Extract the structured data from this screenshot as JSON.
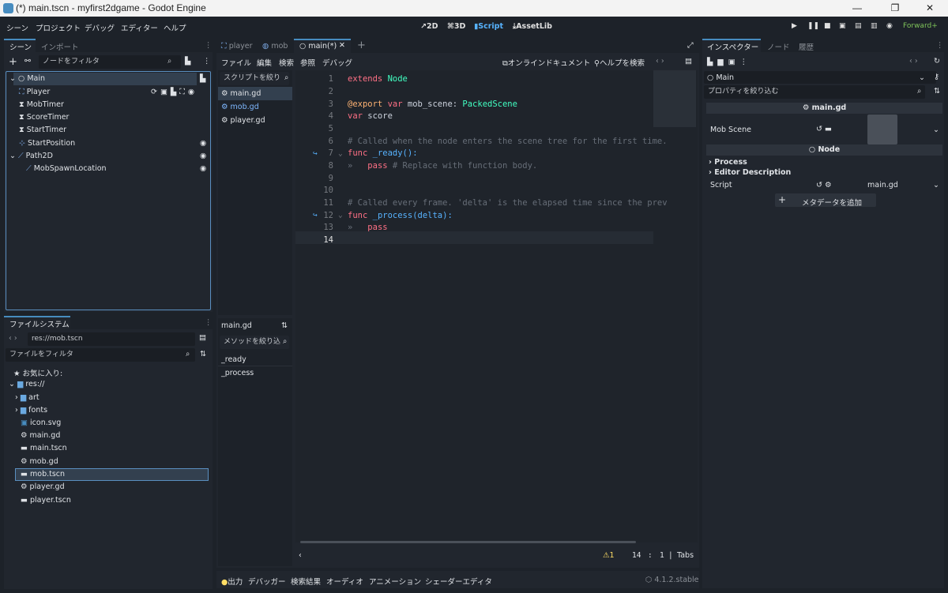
{
  "window": {
    "title": "(*) main.tscn - myfirst2dgame - Godot Engine",
    "minimize": "—",
    "maximize": "❐",
    "close": "✕"
  },
  "menubar": {
    "items": [
      "シーン",
      "プロジェクト",
      "デバッグ",
      "エディター",
      "ヘルプ"
    ],
    "modes": [
      "2D",
      "3D",
      "Script",
      "AssetLib"
    ],
    "renderer": "Forward+"
  },
  "scene_dock": {
    "tabs": [
      "シーン",
      "インポート"
    ],
    "filter_placeholder": "ノードをフィルタ",
    "nodes": [
      "Main",
      "Player",
      "MobTimer",
      "ScoreTimer",
      "StartTimer",
      "StartPosition",
      "Path2D",
      "MobSpawnLocation"
    ]
  },
  "filesystem": {
    "tab": "ファイルシステム",
    "path": "res://mob.tscn",
    "filter_placeholder": "ファイルをフィルタ",
    "favorites": "お気に入り:",
    "root": "res://",
    "items": [
      "art",
      "fonts",
      "icon.svg",
      "main.gd",
      "main.tscn",
      "mob.gd",
      "mob.tscn",
      "player.gd",
      "player.tscn"
    ]
  },
  "script_tabs": [
    "player",
    "mob",
    "main(*)"
  ],
  "script_menu": {
    "items": [
      "ファイル",
      "編集",
      "検索",
      "参照",
      "デバッグ"
    ],
    "online_docs": "オンラインドキュメント",
    "search_help": "ヘルプを検索"
  },
  "script_list": {
    "filter_placeholder": "スクリプトを絞り",
    "items": [
      "main.gd",
      "mob.gd",
      "player.gd"
    ],
    "current": "main.gd",
    "method_filter": "メソッドを絞り込",
    "methods": [
      "_ready",
      "_process"
    ]
  },
  "code": {
    "line_numbers": [
      "1",
      "2",
      "3",
      "4",
      "5",
      "6",
      "7",
      "8",
      "9",
      "10",
      "11",
      "12",
      "13",
      "14"
    ],
    "lines": {
      "l1a": "extends ",
      "l1b": "Node",
      "l3a": "@export ",
      "l3b": "var",
      " l3c": " mob_scene: ",
      "l3d": "PackedScene",
      "l4a": "var",
      " l4b": " score",
      "l6": "# Called when the node enters the scene tree for the first time.",
      "l7a": "func",
      " l7b": " _ready():",
      "l8a": "pass",
      " l8b": " # Replace with function body.",
      "l11": "# Called every frame. 'delta' is the elapsed time since the prev",
      "l12a": "func",
      " l12b": " _process(delta):",
      "l13": "pass"
    },
    "status": {
      "warnings": "1",
      "line": "14",
      "col": "1",
      "indent": "Tabs"
    }
  },
  "bottom": {
    "items": [
      "出力",
      "デバッガー",
      "検索結果",
      "オーディオ",
      "アニメーション",
      "シェーダーエディタ"
    ],
    "version": "4.1.2.stable"
  },
  "inspector": {
    "tabs": [
      "インスペクター",
      "ノード",
      "履歴"
    ],
    "node": "Main",
    "filter_placeholder": "プロパティを絞り込む",
    "script_header": "main.gd",
    "mob_scene_label": "Mob Scene",
    "node_header": "Node",
    "process": "Process",
    "editor_description": "Editor Description",
    "script_label": "Script",
    "script_value": "main.gd",
    "add_metadata": "メタデータを追加"
  },
  "colors": {
    "accent": "#478cbf",
    "keyword": "#ff7085",
    "type": "#42ffc2",
    "comment": "#676e78",
    "annotation": "#ffb373",
    "function": "#57b3ff",
    "warning": "#ffdd65"
  }
}
